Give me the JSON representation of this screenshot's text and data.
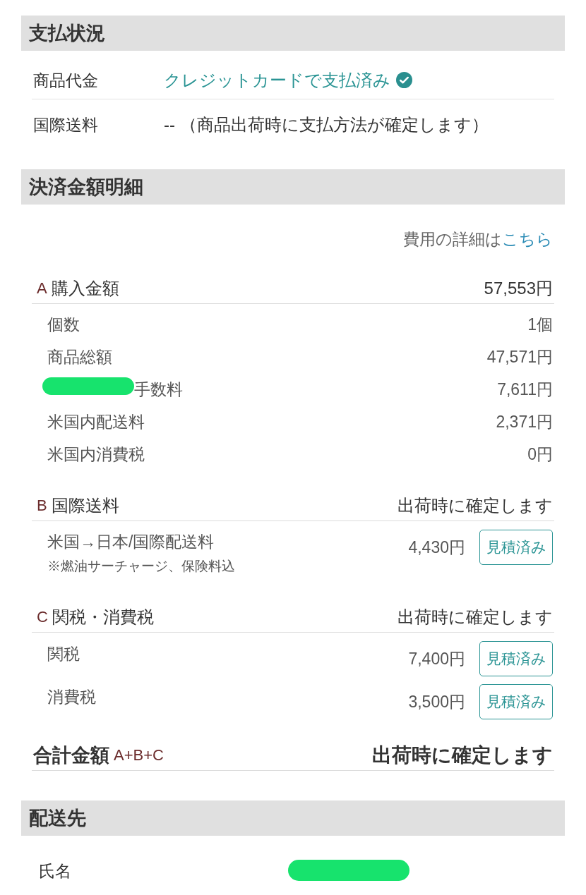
{
  "payment_status": {
    "title": "支払状況",
    "rows": [
      {
        "label": "商品代金",
        "value": "クレジットカードで支払済み",
        "paid": true
      },
      {
        "label": "国際送料",
        "value": "-- （商品出荷時に支払方法が確定します）",
        "paid": false
      }
    ]
  },
  "settlement": {
    "title": "決済金額明細",
    "details": {
      "text": "費用の詳細は",
      "link": "こちら"
    },
    "groups": [
      {
        "letter": "A",
        "title": "購入金額",
        "amount": "57,553円",
        "items": [
          {
            "label": "個数",
            "value": "1個",
            "redacted": false
          },
          {
            "label": "商品総額",
            "value": "47,571円",
            "redacted": false
          },
          {
            "label": "手数料",
            "value": "7,611円",
            "redacted": true
          },
          {
            "label": "米国内配送料",
            "value": "2,371円",
            "redacted": false
          },
          {
            "label": "米国内消費税",
            "value": "0円",
            "redacted": false
          }
        ]
      },
      {
        "letter": "B",
        "title": "国際送料",
        "amount": "出荷時に確定します",
        "items": [
          {
            "label": "米国→日本/国際配送料",
            "note": "※燃油サーチャージ、保険料込",
            "value": "4,430円",
            "badge": "見積済み"
          }
        ]
      },
      {
        "letter": "C",
        "title": "関税・消費税",
        "amount": "出荷時に確定します",
        "items": [
          {
            "label": "関税",
            "value": "7,400円",
            "badge": "見積済み"
          },
          {
            "label": "消費税",
            "value": "3,500円",
            "badge": "見積済み"
          }
        ]
      }
    ],
    "total": {
      "label": "合計金額",
      "formula": "A+B+C",
      "value": "出荷時に確定します"
    }
  },
  "shipping": {
    "title": "配送先",
    "rows": [
      {
        "label": "氏名",
        "redacted": true
      }
    ]
  }
}
